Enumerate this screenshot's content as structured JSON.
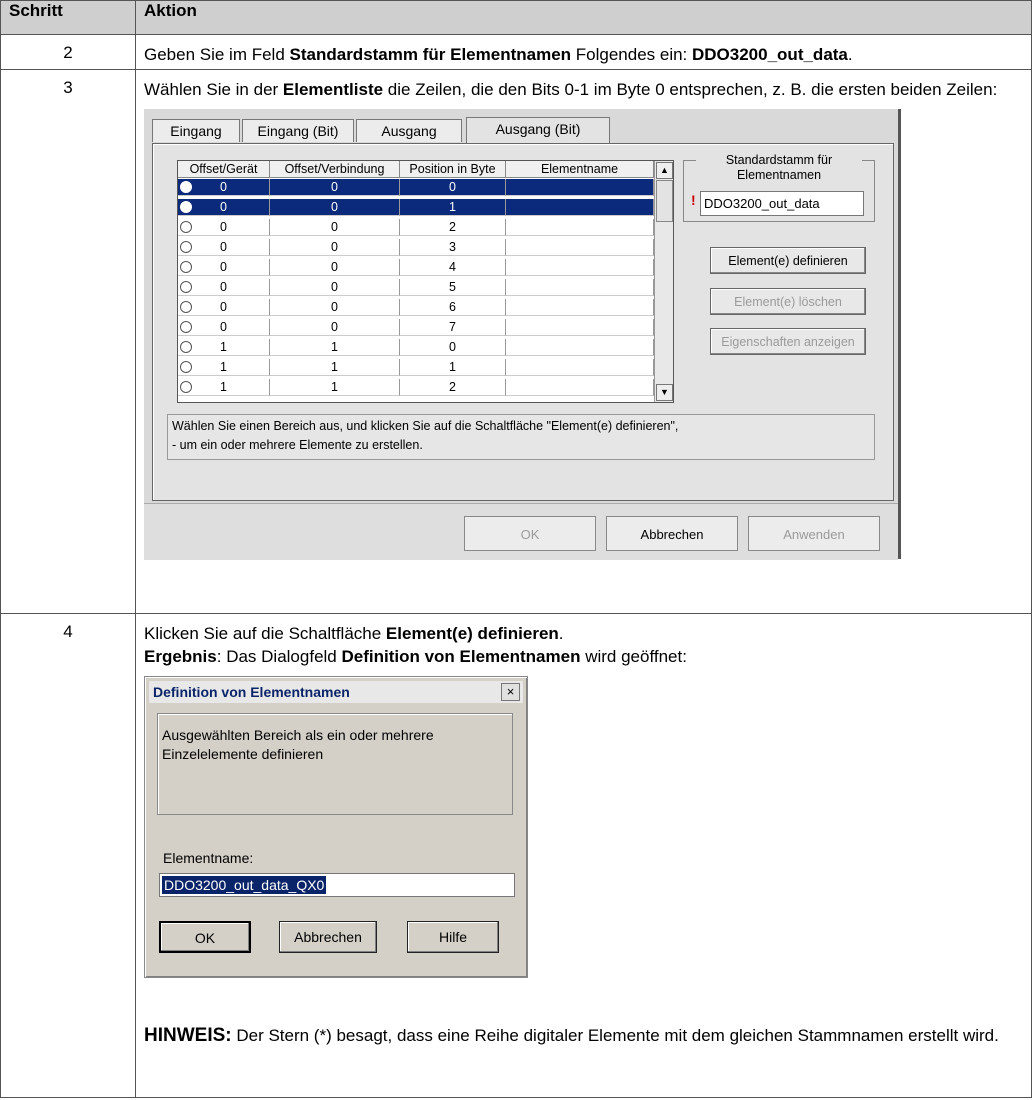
{
  "table": {
    "headers": [
      "Schritt",
      "Aktion"
    ]
  },
  "step2": {
    "num": "2",
    "t1": "Geben Sie im Feld ",
    "b1": "Standardstamm für Elementnamen",
    "t2": " Folgendes ein: ",
    "b2": "DDO3200_out_data",
    "t3": "."
  },
  "step3": {
    "num": "3",
    "t1": "Wählen Sie in der ",
    "b1": "Elementliste",
    "t2": " die Zeilen, die den Bits 0-1 im Byte 0 entsprechen, z. B. die ersten beiden Zeilen:"
  },
  "dialog1": {
    "tabs": [
      "Eingang",
      "Eingang (Bit)",
      "Ausgang",
      "Ausgang (Bit)"
    ],
    "columns": [
      "Offset/Gerät",
      "Offset/Verbindung",
      "Position in Byte",
      "Elementname"
    ],
    "rows": [
      {
        "c1": "0",
        "c2": "0",
        "c3": "0",
        "c4": "",
        "selected": true
      },
      {
        "c1": "0",
        "c2": "0",
        "c3": "1",
        "c4": "",
        "selected": true
      },
      {
        "c1": "0",
        "c2": "0",
        "c3": "2",
        "c4": "",
        "selected": false
      },
      {
        "c1": "0",
        "c2": "0",
        "c3": "3",
        "c4": "",
        "selected": false
      },
      {
        "c1": "0",
        "c2": "0",
        "c3": "4",
        "c4": "",
        "selected": false
      },
      {
        "c1": "0",
        "c2": "0",
        "c3": "5",
        "c4": "",
        "selected": false
      },
      {
        "c1": "0",
        "c2": "0",
        "c3": "6",
        "c4": "",
        "selected": false
      },
      {
        "c1": "0",
        "c2": "0",
        "c3": "7",
        "c4": "",
        "selected": false
      },
      {
        "c1": "1",
        "c2": "1",
        "c3": "0",
        "c4": "",
        "selected": false
      },
      {
        "c1": "1",
        "c2": "1",
        "c3": "1",
        "c4": "",
        "selected": false
      },
      {
        "c1": "1",
        "c2": "1",
        "c3": "2",
        "c4": "",
        "selected": false
      }
    ],
    "stem_label": "Standardstamm für Elementnamen",
    "stem_value": "DDO3200_out_data",
    "warning_mark": "!",
    "btn_define": "Element(e) definieren",
    "btn_delete": "Element(e) löschen",
    "btn_props": "Eigenschaften anzeigen",
    "hint_line1": "Wählen Sie einen Bereich aus, und klicken Sie auf die Schaltfläche \"Element(e) definieren\",",
    "hint_line2": "- um ein oder mehrere Elemente zu erstellen.",
    "btn_ok": "OK",
    "btn_cancel": "Abbrechen",
    "btn_apply": "Anwenden"
  },
  "step4": {
    "num": "4",
    "t1": "Klicken Sie auf die Schaltfläche ",
    "b1": "Element(e) definieren",
    "t2": ".",
    "r_label": "Ergebnis",
    "r_t1": ": Das Dialogfeld ",
    "r_b1": "Definition von Elementnamen",
    "r_t2": " wird geöffnet:",
    "note_label": "HINWEIS:",
    "note_text": " Der Stern (*) besagt, dass eine Reihe digitaler Elemente mit dem gleichen Stammnamen erstellt wird."
  },
  "dialog2": {
    "title": "Definition von Elementnamen",
    "close": "×",
    "desc_line1": "Ausgewählten Bereich als ein oder mehrere",
    "desc_line2": "Einzelelemente definieren",
    "label": "Elementname:",
    "value": "DDO3200_out_data_QX0",
    "btn_ok": "OK",
    "btn_cancel": "Abbrechen",
    "btn_help": "Hilfe"
  }
}
